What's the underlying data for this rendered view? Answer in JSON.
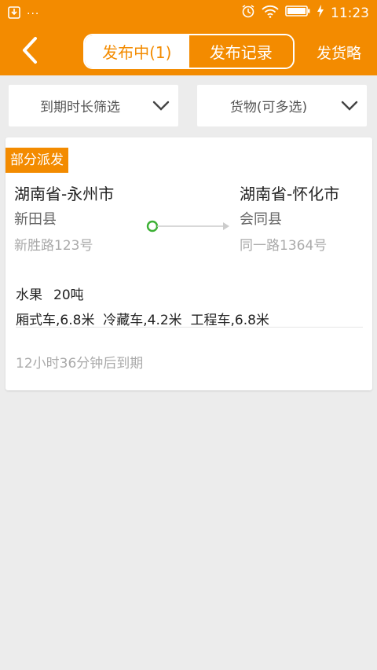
{
  "status_bar": {
    "left_icons": [
      "download-icon",
      "more-dots-icon"
    ],
    "more_dots": "···",
    "right_icons": [
      "alarm-icon",
      "wifi-icon",
      "battery-icon",
      "charging-icon"
    ],
    "time": "11:23"
  },
  "app_bar": {
    "back_icon": "back-chevron-icon",
    "tabs": [
      {
        "label": "发布中(1)",
        "active": true
      },
      {
        "label": "发布记录",
        "active": false
      }
    ],
    "guide_label": "发货略"
  },
  "filters": [
    {
      "label": "到期时长筛选",
      "icon": "chevron-down-icon"
    },
    {
      "label": "货物(可多选)",
      "icon": "chevron-down-icon"
    }
  ],
  "shipment": {
    "badge": "部分派发",
    "origin": {
      "city": "湖南省-永州市",
      "county": "新田县",
      "street": "新胜路123号"
    },
    "destination": {
      "city": "湖南省-怀化市",
      "county": "会同县",
      "street": "同一路1364号"
    },
    "cargo_name": "水果",
    "cargo_weight": "20吨",
    "vehicles": "厢式车,6.8米  冷藏车,4.2米  工程车,6.8米",
    "expire_text": "12小时36分钟后到期"
  },
  "colors": {
    "brand": "#f38b00",
    "background": "#ececec",
    "route_dot": "#3cb034"
  }
}
